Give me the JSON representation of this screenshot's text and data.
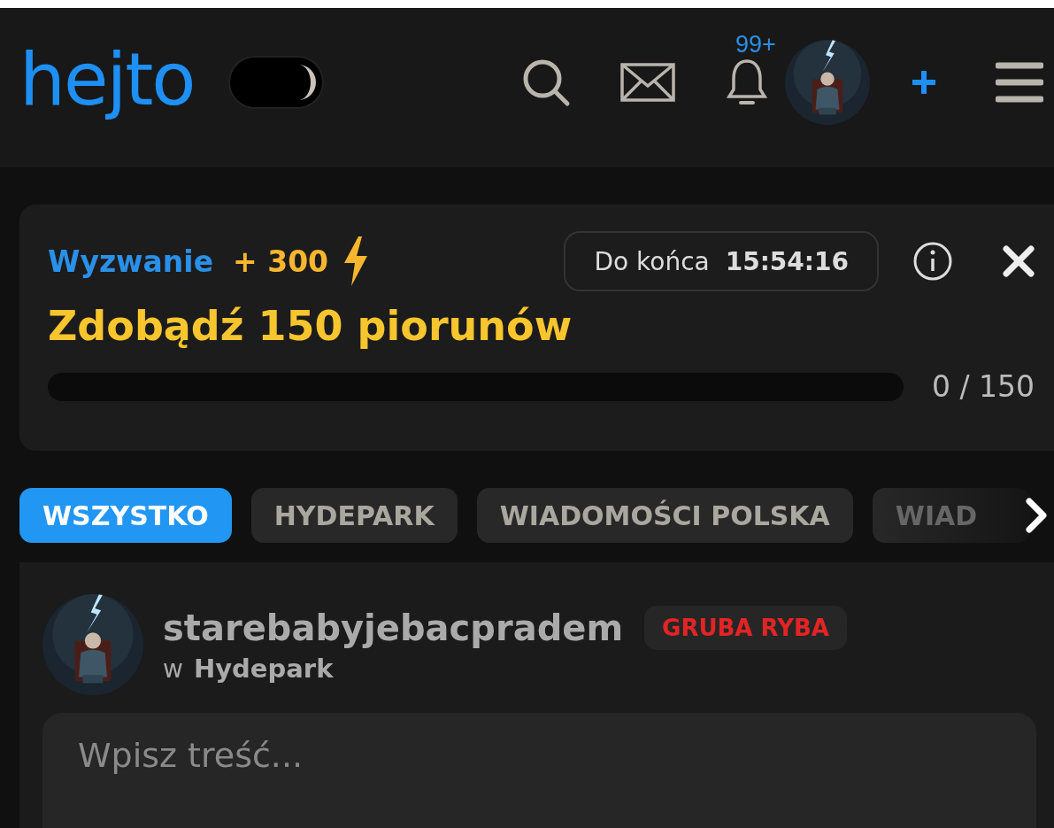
{
  "header": {
    "logo": "hejto",
    "dark_mode": {
      "on": true
    },
    "notifications": {
      "badge": "99+"
    }
  },
  "challenge": {
    "label": "Wyzwanie",
    "reward": "+ 300",
    "timer_label": "Do końca",
    "timer": "15:54:16",
    "title": "Zdobądź 150 piorunów",
    "progress": {
      "level": 0,
      "reading": "0 / 150"
    }
  },
  "tabs": [
    {
      "label": "WSZYSTKO",
      "selected": true
    },
    {
      "label": "HYDEPARK",
      "selected": false
    },
    {
      "label": "WIADOMOŚCI POLSKA",
      "selected": false
    },
    {
      "label": "WIAD",
      "selected": false
    }
  ],
  "post_form": {
    "author": "starebabyjebacpradem",
    "rank": "GRUBA RYBA",
    "community_prefix": "w",
    "community": "Hydepark",
    "placeholder": "Wpisz treść..."
  }
}
